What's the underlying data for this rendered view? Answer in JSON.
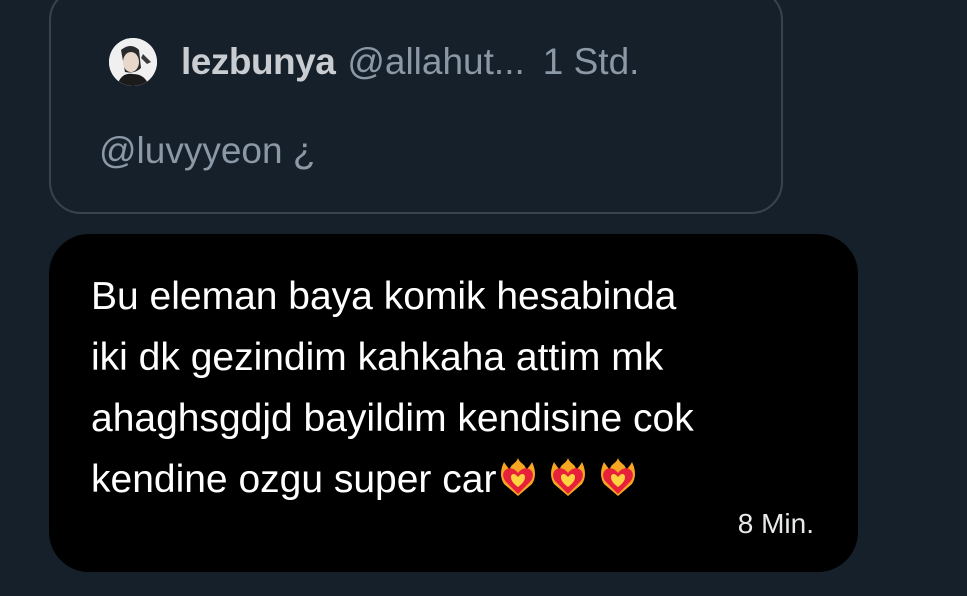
{
  "quoted_tweet": {
    "display_name": "lezbunya",
    "handle": "@allahut...",
    "timestamp": "1 Std.",
    "text": "@luvyyeon ¿",
    "avatar_icon": "user-avatar"
  },
  "message": {
    "lines": [
      "Bu eleman baya komik hesabinda",
      "iki dk gezindim kahkaha attim mk",
      "ahaghsgdjd bayildim kendisine cok",
      "kendine ozgu super car"
    ],
    "emojis": [
      "heart-on-fire-icon",
      "heart-on-fire-icon",
      "heart-on-fire-icon"
    ],
    "timestamp": "8 Min."
  },
  "colors": {
    "background": "#15202b",
    "bubble": "#000000",
    "quote_border": "#38444d",
    "secondary_text": "#8b98a5",
    "primary_text": "#ffffff"
  }
}
